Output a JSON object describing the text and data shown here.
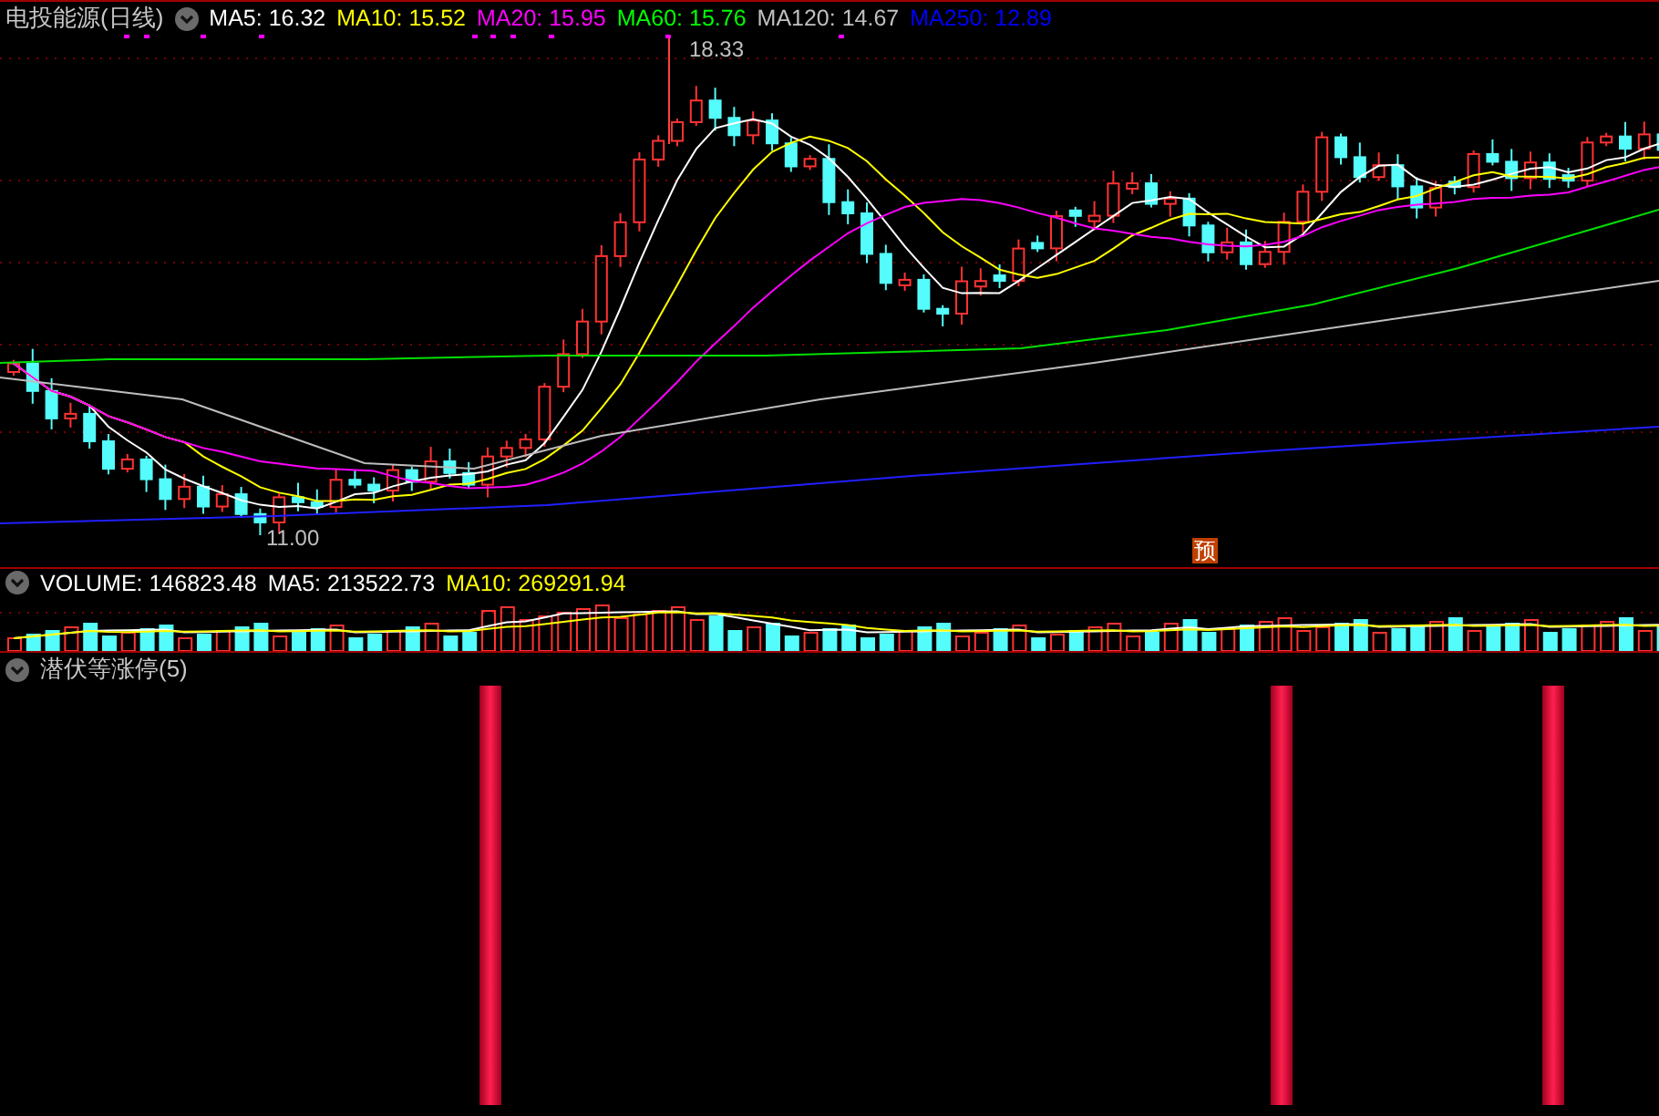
{
  "price_pane": {
    "title": "电投能源(日线)",
    "indicators": [
      {
        "label": "MA5: 16.32",
        "color": "#ffffff"
      },
      {
        "label": "MA10: 15.52",
        "color": "#ffff00"
      },
      {
        "label": "MA20: 15.95",
        "color": "#ff00ff"
      },
      {
        "label": "MA60: 15.76",
        "color": "#00ff00"
      },
      {
        "label": "MA120: 14.67",
        "color": "#c0c0c0"
      },
      {
        "label": "MA250: 12.89",
        "color": "#0000ff"
      }
    ],
    "high_label": "18.33",
    "low_label": "11.00",
    "badge": "预"
  },
  "volume_pane": {
    "indicators": [
      {
        "label": "VOLUME: 146823.48",
        "color": "#ffffff"
      },
      {
        "label": "MA5: 213522.73",
        "color": "#ffffff"
      },
      {
        "label": "MA10: 269291.94",
        "color": "#ffff00"
      }
    ]
  },
  "signal_pane": {
    "title": "潜伏等涨停(5)"
  }
}
